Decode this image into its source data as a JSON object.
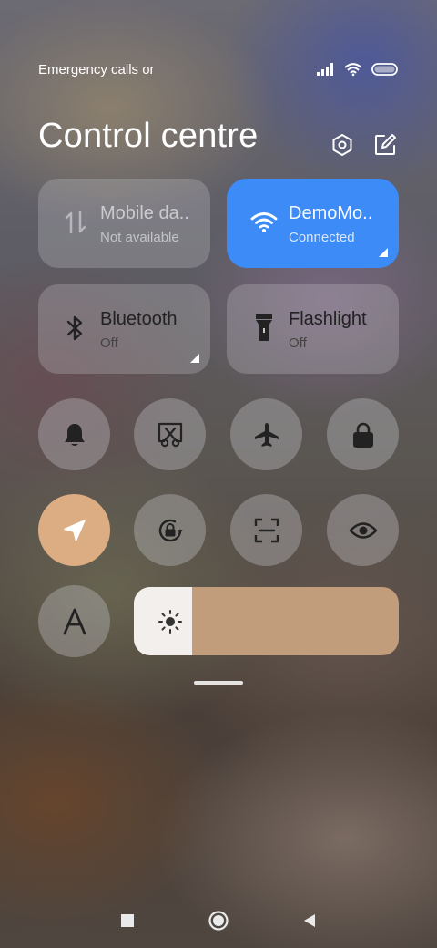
{
  "status_bar": {
    "carrier_text": "Emergency calls only",
    "icons": [
      "signal-icon",
      "wifi-icon",
      "battery-icon"
    ]
  },
  "header": {
    "title": "Control centre",
    "buttons": [
      "settings-icon",
      "edit-icon"
    ]
  },
  "tiles": [
    {
      "label": "Mobile da..",
      "sub": "Not available",
      "icon": "mobile-data-icon",
      "active": false
    },
    {
      "label": "DemoMo..",
      "sub": "Connected",
      "icon": "wifi-icon",
      "active": true
    },
    {
      "label": "Bluetooth",
      "sub": "Off",
      "icon": "bluetooth-icon",
      "active": false
    },
    {
      "label": "Flashlight",
      "sub": "Off",
      "icon": "flashlight-icon",
      "active": false
    }
  ],
  "toggles": [
    {
      "icon": "bell-icon",
      "active": false
    },
    {
      "icon": "screenshot-icon",
      "active": false
    },
    {
      "icon": "airplane-icon",
      "active": false
    },
    {
      "icon": "lock-icon",
      "active": false
    },
    {
      "icon": "location-icon",
      "active": true
    },
    {
      "icon": "rotation-lock-icon",
      "active": false
    },
    {
      "icon": "scanner-icon",
      "active": false
    },
    {
      "icon": "eye-icon",
      "active": false
    },
    {
      "icon": "font-size-icon",
      "active": false
    }
  ],
  "brightness": {
    "icon": "brightness-icon",
    "level": 0.22
  },
  "colors": {
    "wifi_active": "#3c8bf7",
    "location_active": "#dcad82",
    "brightness_track": "#c29d7c"
  },
  "nav_bar": [
    "recents-icon",
    "home-icon",
    "back-icon"
  ]
}
